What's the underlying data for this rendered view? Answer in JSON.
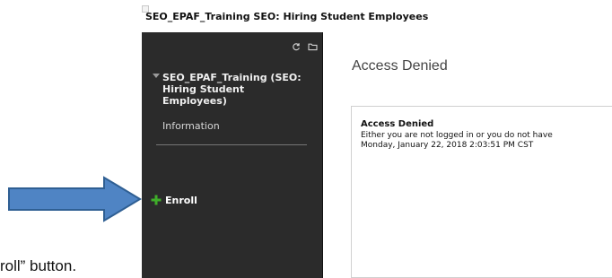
{
  "window": {
    "title": "SEO_EPAF_Training SEO: Hiring Student Employees",
    "title_icon": "broken-image-icon"
  },
  "sidebar": {
    "tool_icons": [
      "refresh-icon",
      "folder-icon"
    ],
    "course_title": "SEO_EPAF_Training (SEO: Hiring Student Employees)",
    "toggle_icon": "caret-down-icon",
    "items": [
      {
        "label": "Information"
      }
    ],
    "enroll": {
      "label": "Enroll",
      "icon": "plus-icon",
      "icon_color": "#3fae2a"
    },
    "background_color": "#2b2b2b"
  },
  "main": {
    "heading": "Access Denied",
    "message": {
      "title": "Access Denied",
      "line1": "Either you are not logged in or you do not have",
      "line2": "Monday, January 22, 2018 2:03:51 PM CST"
    }
  },
  "annotation": {
    "arrow_color": "#4f84c4",
    "arrow_stroke": "#2f5f93",
    "caption": "roll” button."
  }
}
